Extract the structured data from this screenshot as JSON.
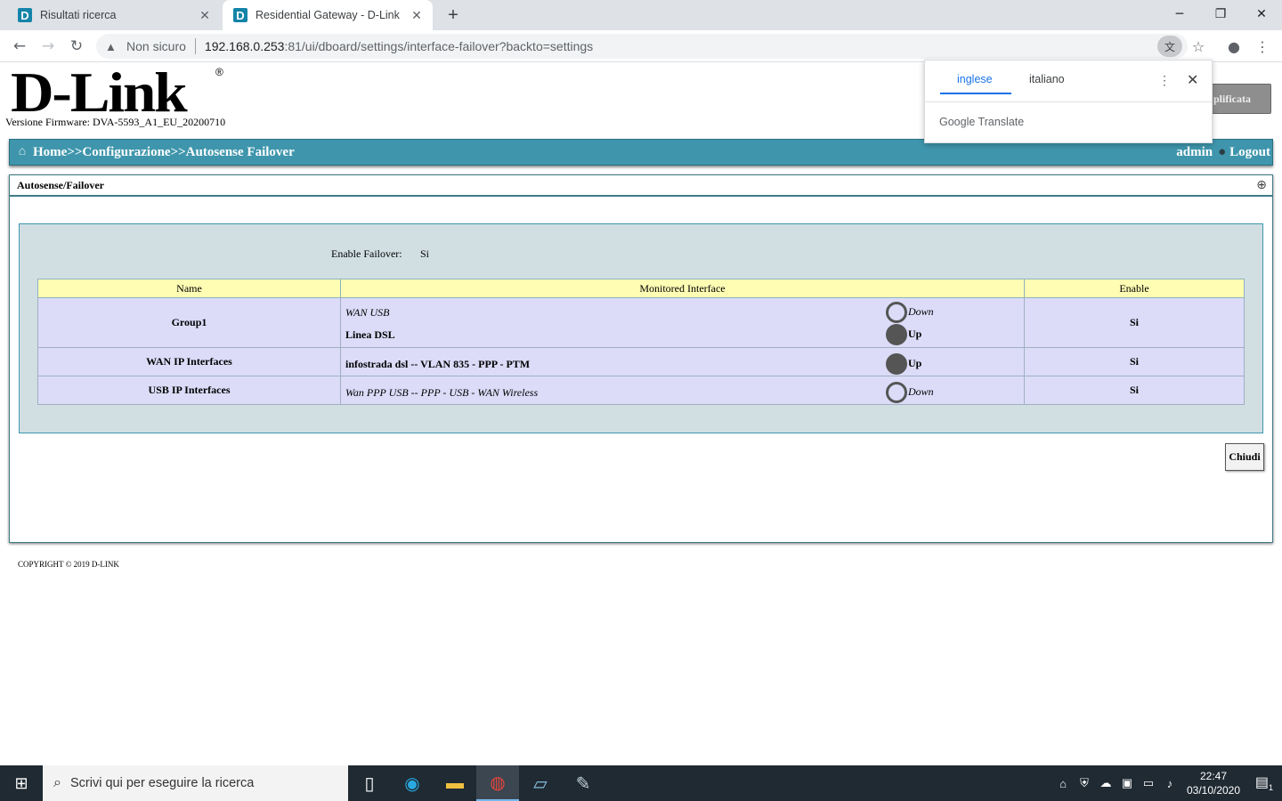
{
  "browser": {
    "tabs": [
      {
        "title": "Risultati ricerca",
        "favicon": "D"
      },
      {
        "title": "Residential Gateway - D-Link",
        "favicon": "D"
      }
    ],
    "not_secure": "Non sicuro",
    "url_host": "192.168.0.253",
    "url_rest": ":81/ui/dboard/settings/interface-failover?backto=settings"
  },
  "translate_popup": {
    "lang_selected": "inglese",
    "lang_other": "italiano",
    "brand": "Google Translate"
  },
  "page": {
    "logo": "D-Link",
    "logo_reg": "®",
    "firmware": "Versione Firmware: DVA-5593_A1_EU_20200710",
    "header_button": "plificata",
    "breadcrumb": "Home>>Configurazione>>Autosense Failover",
    "user": "admin",
    "logout": "Logout",
    "panel_title": "Autosense/Failover",
    "enable_failover_label": "Enable Failover:",
    "enable_failover_value": "Si",
    "columns": [
      "Name",
      "Monitored Interface",
      "Enable"
    ],
    "rows": [
      {
        "name": "Group1",
        "enable": "Si",
        "interfaces": [
          {
            "label": "WAN USB",
            "status": "Down"
          },
          {
            "label": "Linea DSL",
            "status": "Up"
          }
        ]
      },
      {
        "name": "WAN IP Interfaces",
        "enable": "Si",
        "interfaces": [
          {
            "label": "infostrada dsl -- VLAN 835 - PPP - PTM",
            "status": "Up"
          }
        ]
      },
      {
        "name": "USB IP Interfaces",
        "enable": "Si",
        "interfaces": [
          {
            "label": "Wan PPP USB -- PPP - USB - WAN Wireless",
            "status": "Down"
          }
        ]
      }
    ],
    "close_button": "Chiudi",
    "copyright": "COPYRIGHT © 2019 D-LINK"
  },
  "taskbar": {
    "search_placeholder": "Scrivi qui per eseguire la ricerca",
    "time": "22:47",
    "date": "03/10/2020",
    "notification_count": "1"
  },
  "colors": {
    "topbar": "#3f96ac",
    "table_header": "#fffdb4",
    "row_bg": "#dcdcf9"
  }
}
